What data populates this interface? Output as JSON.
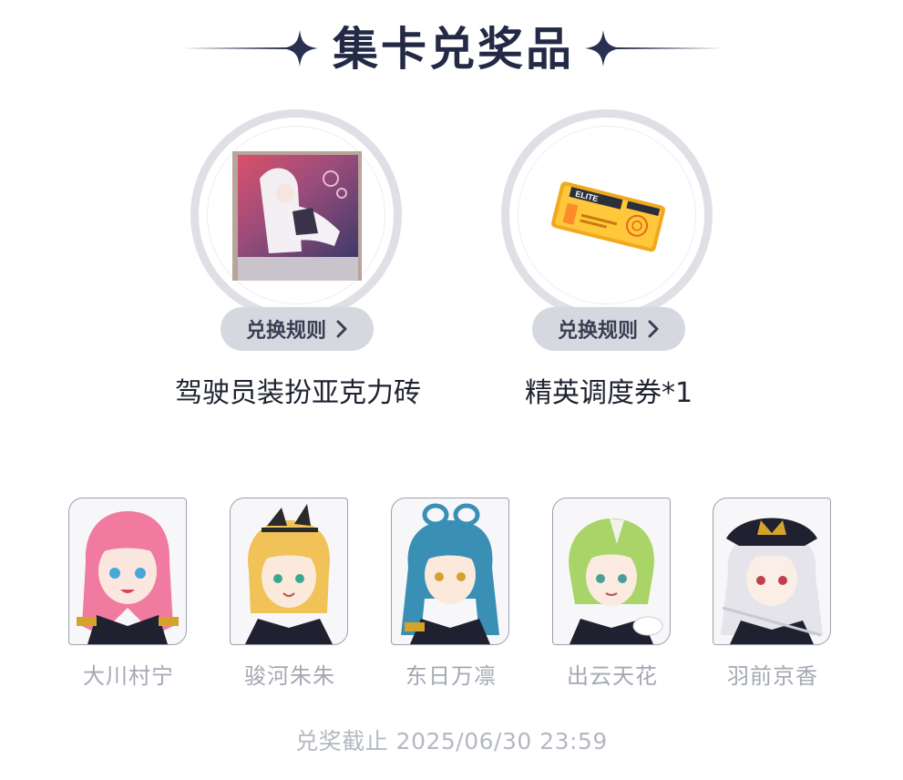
{
  "header": {
    "title": "集卡兑奖品"
  },
  "prizes": [
    {
      "name": "驾驶员装扮亚克力砖",
      "rule_label": "兑换规则"
    },
    {
      "name": "精英调度券*1",
      "rule_label": "兑换规则",
      "ticket_text": "ELITE"
    }
  ],
  "characters": [
    {
      "name": "大川村宁",
      "hair": "#f07aa0"
    },
    {
      "name": "骏河朱朱",
      "hair": "#f0c257"
    },
    {
      "name": "东日万凛",
      "hair": "#3a8fb5"
    },
    {
      "name": "出云天花",
      "hair": "#a9d468"
    },
    {
      "name": "羽前京香",
      "hair": "#e4e4ea"
    }
  ],
  "deadline": "兑奖截止 2025/06/30 23:59",
  "colors": {
    "title": "#232a45",
    "button_bg": "#d6d8e0",
    "ring": "#dfe0e6",
    "muted_text": "#a4a8b3"
  }
}
